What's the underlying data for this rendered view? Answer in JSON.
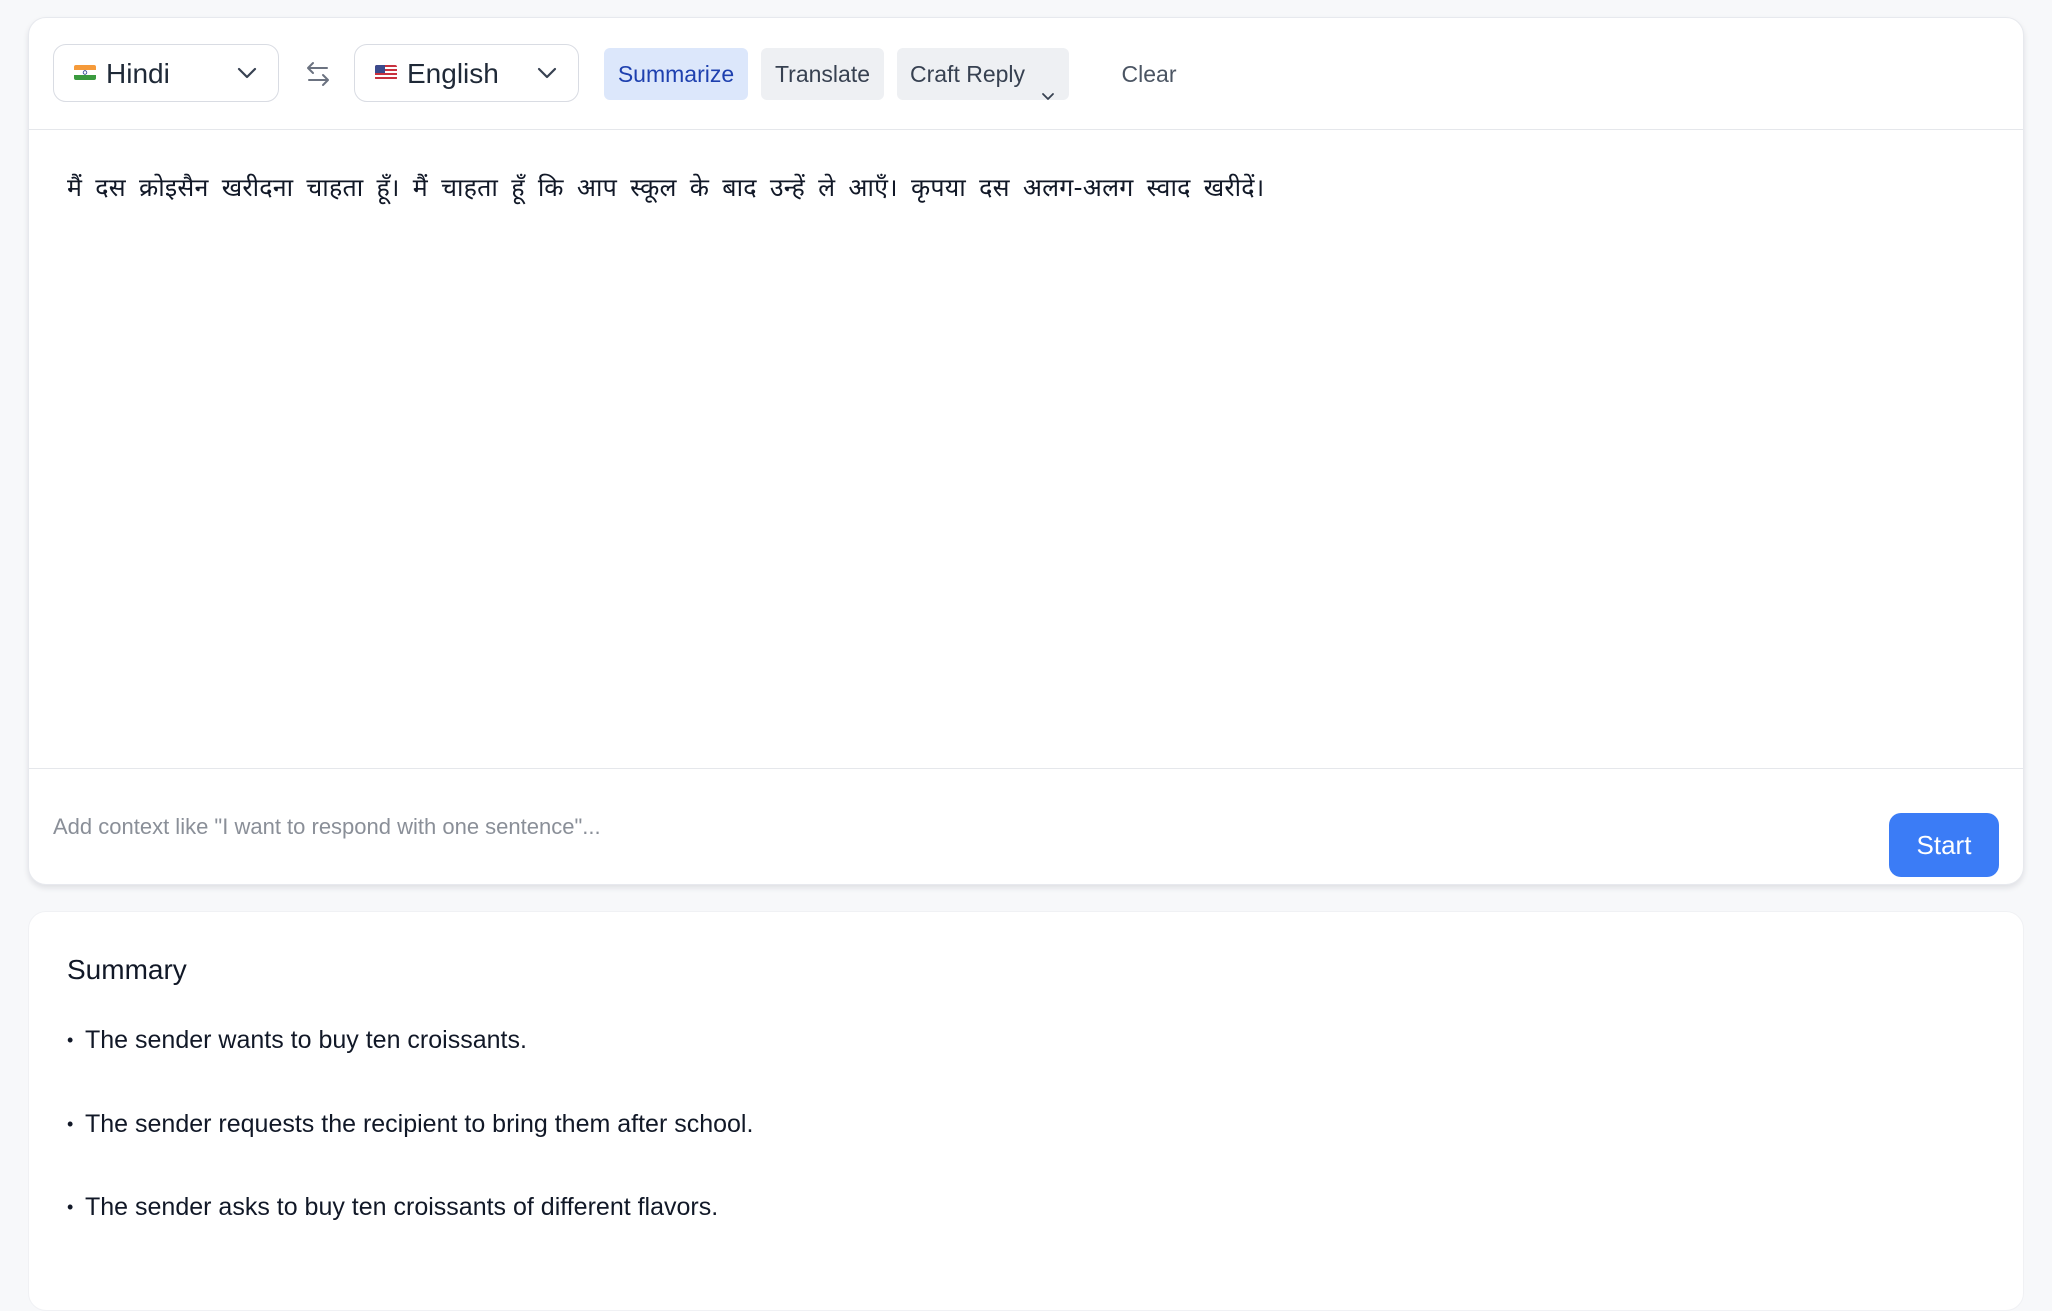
{
  "toolbar": {
    "source_language": "Hindi",
    "target_language": "English",
    "summarize_label": "Summarize",
    "translate_label": "Translate",
    "craft_reply_label": "Craft Reply",
    "clear_label": "Clear"
  },
  "source_text": "मैं दस क्रोइसैन खरीदना चाहता हूँ। मैं चाहता हूँ कि आप स्कूल के बाद उन्हें ले आएँ। कृपया दस अलग-अलग स्वाद खरीदें।",
  "context": {
    "placeholder": "Add context like \"I want to respond with one sentence\"...",
    "value": ""
  },
  "start_label": "Start",
  "summary": {
    "title": "Summary",
    "bullet": "•",
    "items": [
      "The sender wants to buy ten croissants.",
      "The sender requests the recipient to bring them after school.",
      "The sender asks to buy ten croissants of different flavors."
    ]
  },
  "colors": {
    "accent": "#3b7cf6",
    "summarize_bg": "#dce7fb",
    "summarize_text": "#1e40af",
    "button_bg": "#eef0f3"
  }
}
